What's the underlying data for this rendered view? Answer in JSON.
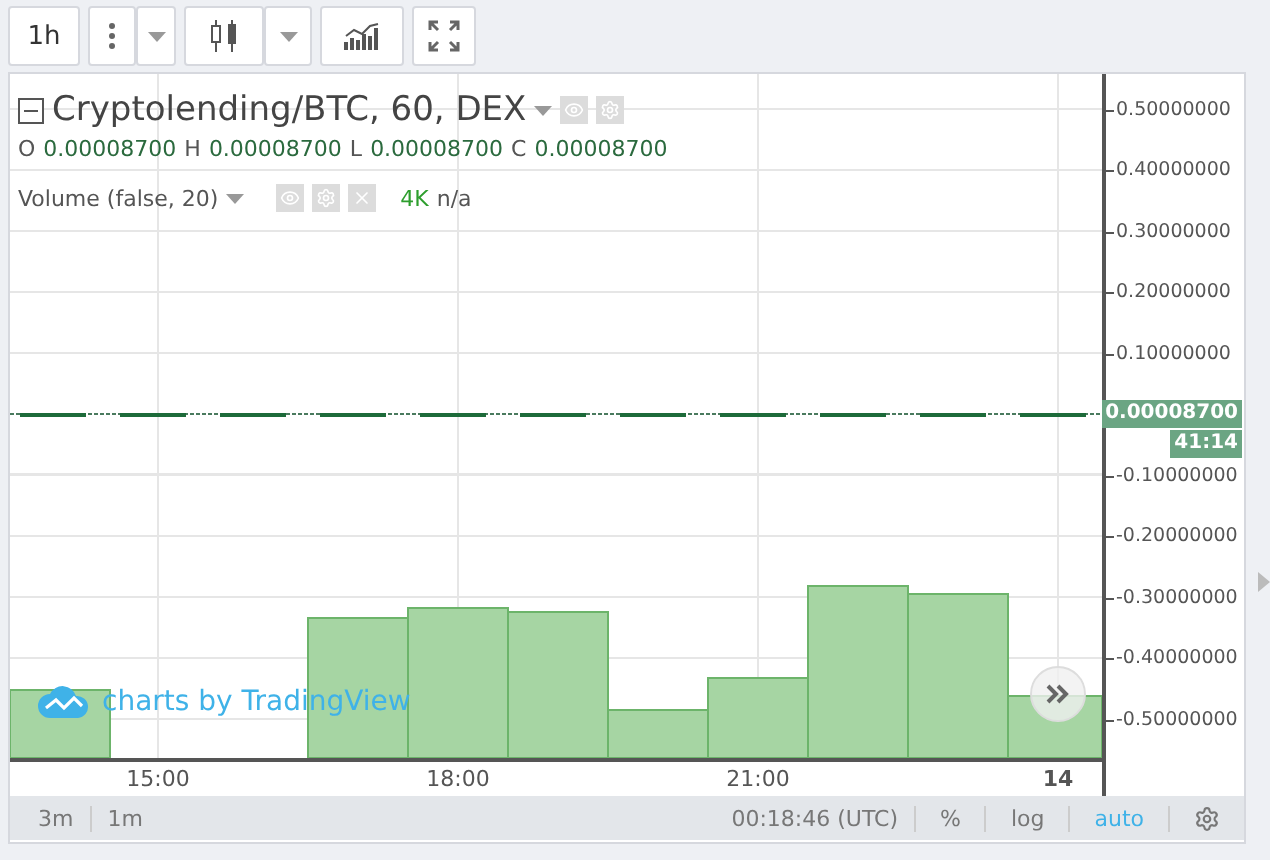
{
  "toolbar": {
    "interval": "1h"
  },
  "legend": {
    "title": "Cryptolending/BTC, 60, DEX",
    "ohlc": [
      {
        "label": "O",
        "value": "0.00008700"
      },
      {
        "label": "H",
        "value": "0.00008700"
      },
      {
        "label": "L",
        "value": "0.00008700"
      },
      {
        "label": "C",
        "value": "0.00008700"
      }
    ],
    "volume": {
      "label": "Volume (false, 20)",
      "value": "4K",
      "extra": "n/a"
    }
  },
  "price_axis": {
    "ticks": [
      "0.50000000",
      "0.40000000",
      "0.30000000",
      "0.20000000",
      "0.10000000",
      "-0.10000000",
      "-0.20000000",
      "-0.30000000",
      "-0.40000000",
      "-0.50000000"
    ],
    "last_price": "0.00008700",
    "countdown": "41:14"
  },
  "time_axis": {
    "ticks": [
      {
        "label": "15:00",
        "kind": "time"
      },
      {
        "label": "18:00",
        "kind": "time"
      },
      {
        "label": "21:00",
        "kind": "time"
      },
      {
        "label": "14",
        "kind": "day"
      }
    ]
  },
  "watermark": "charts by TradingView",
  "bottom_bar": {
    "intervals": [
      "3m",
      "1m"
    ],
    "clock": "00:18:46 (UTC)",
    "options": [
      {
        "label": "%",
        "selected": false
      },
      {
        "label": "log",
        "selected": false
      },
      {
        "label": "auto",
        "selected": true
      }
    ]
  }
}
